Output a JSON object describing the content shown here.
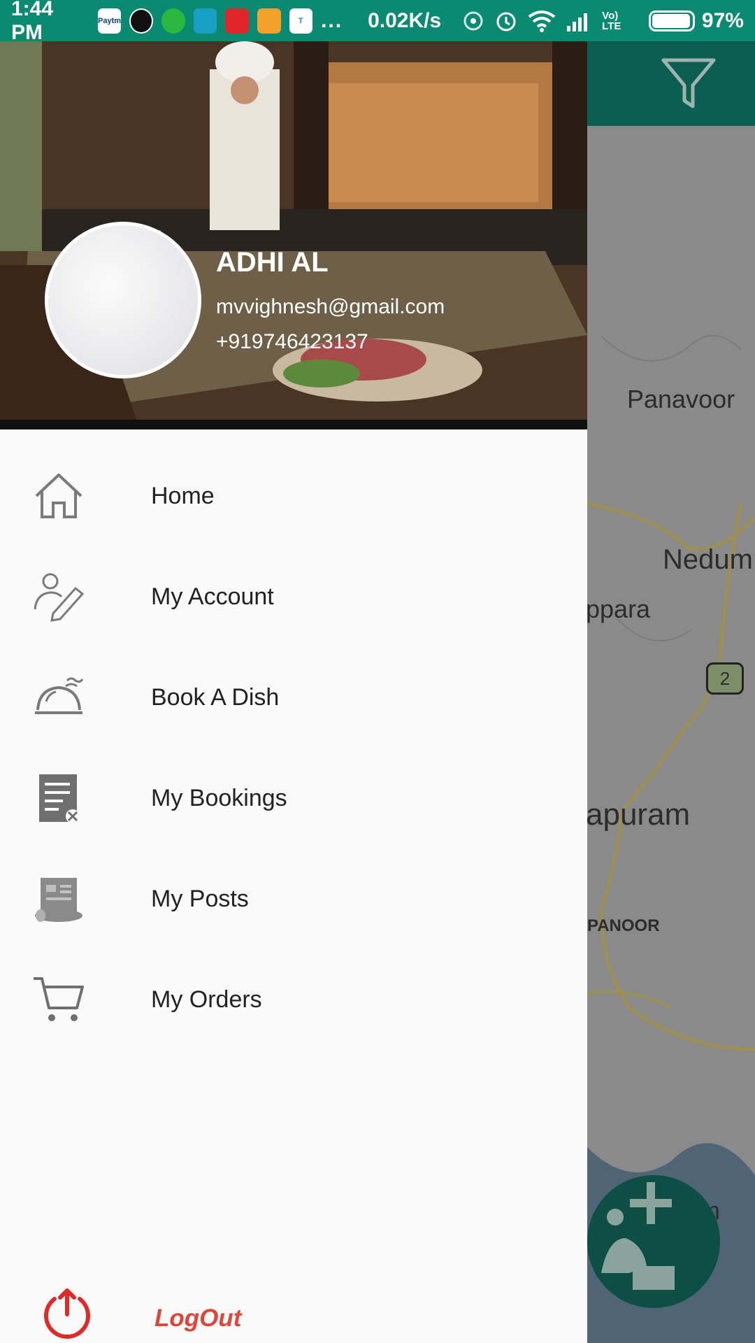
{
  "status_bar": {
    "time": "1:44 PM",
    "app_icons": [
      "paytm",
      "phonepe",
      "whatsapp",
      "app",
      "airtel",
      "chat",
      "truecaller"
    ],
    "more": "...",
    "speed": "0.02K/s",
    "battery_percent": "97%",
    "battery_level": 0.97,
    "network_label": "Vo) LTE"
  },
  "map": {
    "labels": [
      "Panavoor",
      "Nedum",
      "ppara",
      "apuram",
      "PANOOR",
      "m"
    ],
    "route_marker": "2"
  },
  "drawer": {
    "profile": {
      "name": "ADHI AL",
      "email": "mvvighnesh@gmail.com",
      "phone": "+919746423137"
    },
    "menu": [
      {
        "label": "Home",
        "icon": "home-icon"
      },
      {
        "label": "My Account",
        "icon": "account-edit-icon"
      },
      {
        "label": "Book A Dish",
        "icon": "cloche-icon"
      },
      {
        "label": "My Bookings",
        "icon": "bookings-icon"
      },
      {
        "label": "My Posts",
        "icon": "posts-icon"
      },
      {
        "label": "My Orders",
        "icon": "cart-icon"
      }
    ],
    "logout_label": "LogOut",
    "logout_icon": "power-icon"
  },
  "colors": {
    "status_bar": "#0b8a72",
    "app_bar": "#0c5e52",
    "logout": "#e0443a",
    "drawer_bg": "#fafafa"
  }
}
